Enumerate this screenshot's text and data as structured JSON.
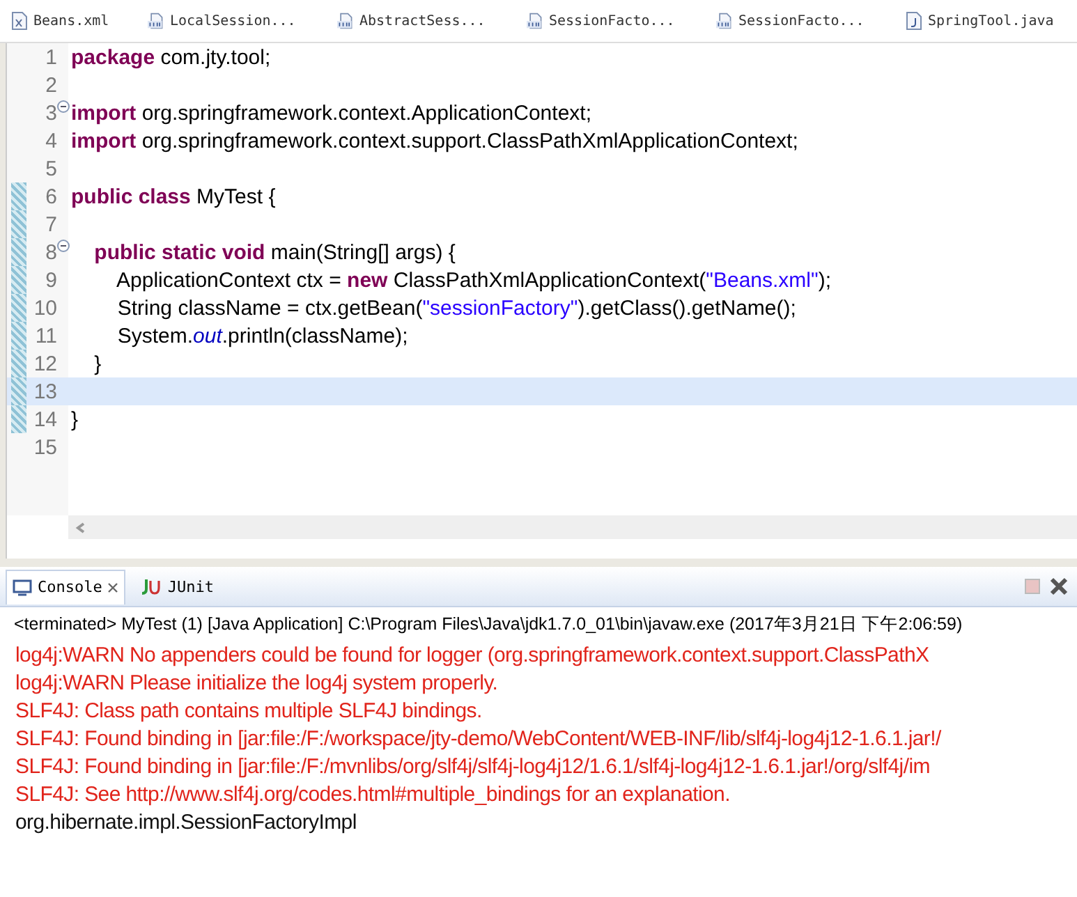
{
  "editor_tabs": [
    {
      "label": "Beans.xml",
      "kind": "xml"
    },
    {
      "label": "LocalSession...",
      "kind": "class"
    },
    {
      "label": "AbstractSess...",
      "kind": "class"
    },
    {
      "label": "SessionFacto...",
      "kind": "class"
    },
    {
      "label": "SessionFacto...",
      "kind": "class"
    },
    {
      "label": "SpringTool.java",
      "kind": "java"
    }
  ],
  "editor": {
    "lines": [
      {
        "number": "1",
        "folded": false,
        "changed": false,
        "current": false,
        "segments": [
          {
            "kind": "keyword",
            "text": "package"
          },
          {
            "kind": "plain",
            "text": " com.jty.tool;"
          }
        ]
      },
      {
        "number": "2",
        "folded": false,
        "changed": false,
        "current": false
      },
      {
        "number": "3",
        "folded": true,
        "changed": false,
        "current": false,
        "segments": [
          {
            "kind": "keyword",
            "text": "import"
          },
          {
            "kind": "plain",
            "text": " org.springframework.context.ApplicationContext;"
          }
        ]
      },
      {
        "number": "4",
        "folded": false,
        "changed": false,
        "current": false,
        "segments": [
          {
            "kind": "keyword",
            "text": "import"
          },
          {
            "kind": "plain",
            "text": " org.springframework.context.support.ClassPathXmlApplicationContext;"
          }
        ]
      },
      {
        "number": "5",
        "folded": false,
        "changed": false,
        "current": false
      },
      {
        "number": "6",
        "folded": false,
        "changed": true,
        "current": false,
        "segments": [
          {
            "kind": "keyword",
            "text": "public class"
          },
          {
            "kind": "plain",
            "text": " MyTest {"
          }
        ]
      },
      {
        "number": "7",
        "folded": false,
        "changed": true,
        "current": false
      },
      {
        "number": "8",
        "folded": true,
        "changed": true,
        "current": false,
        "segments": [
          {
            "kind": "keyword",
            "text": "    public static void"
          },
          {
            "kind": "plain",
            "text": " main(String[] args) {"
          }
        ]
      },
      {
        "number": "9",
        "folded": false,
        "changed": true,
        "current": false,
        "segments": [
          {
            "kind": "plain",
            "text": "        ApplicationContext ctx = "
          },
          {
            "kind": "keyword",
            "text": "new"
          },
          {
            "kind": "plain",
            "text": " ClassPathXmlApplicationContext("
          },
          {
            "kind": "string",
            "text": "\"Beans.xml\""
          },
          {
            "kind": "plain",
            "text": ");"
          }
        ]
      },
      {
        "number": "10",
        "folded": false,
        "changed": true,
        "current": false,
        "segments": [
          {
            "kind": "plain",
            "text": "        String className = ctx.getBean("
          },
          {
            "kind": "string",
            "text": "\"sessionFactory\""
          },
          {
            "kind": "plain",
            "text": ").getClass().getName();"
          }
        ]
      },
      {
        "number": "11",
        "folded": false,
        "changed": true,
        "current": false,
        "segments": [
          {
            "kind": "plain",
            "text": "        System."
          },
          {
            "kind": "field",
            "text": "out"
          },
          {
            "kind": "plain",
            "text": ".println(className);"
          }
        ]
      },
      {
        "number": "12",
        "folded": false,
        "changed": true,
        "current": false,
        "segments": [
          {
            "kind": "plain",
            "text": "    }"
          }
        ]
      },
      {
        "number": "13",
        "folded": false,
        "changed": true,
        "current": true
      },
      {
        "number": "14",
        "folded": false,
        "changed": true,
        "current": false,
        "segments": [
          {
            "kind": "plain",
            "text": "}"
          }
        ]
      },
      {
        "number": "15",
        "folded": false,
        "changed": false,
        "current": false
      }
    ]
  },
  "console": {
    "tabs": [
      {
        "label": "Console",
        "kind": "console",
        "selected": true
      },
      {
        "label": "JUnit",
        "kind": "junit",
        "selected": false
      }
    ],
    "status": "<terminated> MyTest (1) [Java Application] C:\\Program Files\\Java\\jdk1.7.0_01\\bin\\javaw.exe (2017年3月21日 下午2:06:59)",
    "output": [
      {
        "kind": "error",
        "text": "log4j:WARN No appenders could be found for logger (org.springframework.context.support.ClassPathX"
      },
      {
        "kind": "error",
        "text": "log4j:WARN Please initialize the log4j system properly."
      },
      {
        "kind": "error",
        "text": "SLF4J: Class path contains multiple SLF4J bindings."
      },
      {
        "kind": "error",
        "text": "SLF4J: Found binding in [jar:file:/F:/workspace/jty-demo/WebContent/WEB-INF/lib/slf4j-log4j12-1.6.1.jar!/"
      },
      {
        "kind": "error",
        "text": "SLF4J: Found binding in [jar:file:/F:/mvnlibs/org/slf4j/slf4j-log4j12/1.6.1/slf4j-log4j12-1.6.1.jar!/org/slf4j/im"
      },
      {
        "kind": "error",
        "text": "SLF4J: See http://www.slf4j.org/codes.html#multiple_bindings for an explanation."
      },
      {
        "kind": "plain",
        "text": "org.hibernate.impl.SessionFactoryImpl"
      }
    ]
  }
}
